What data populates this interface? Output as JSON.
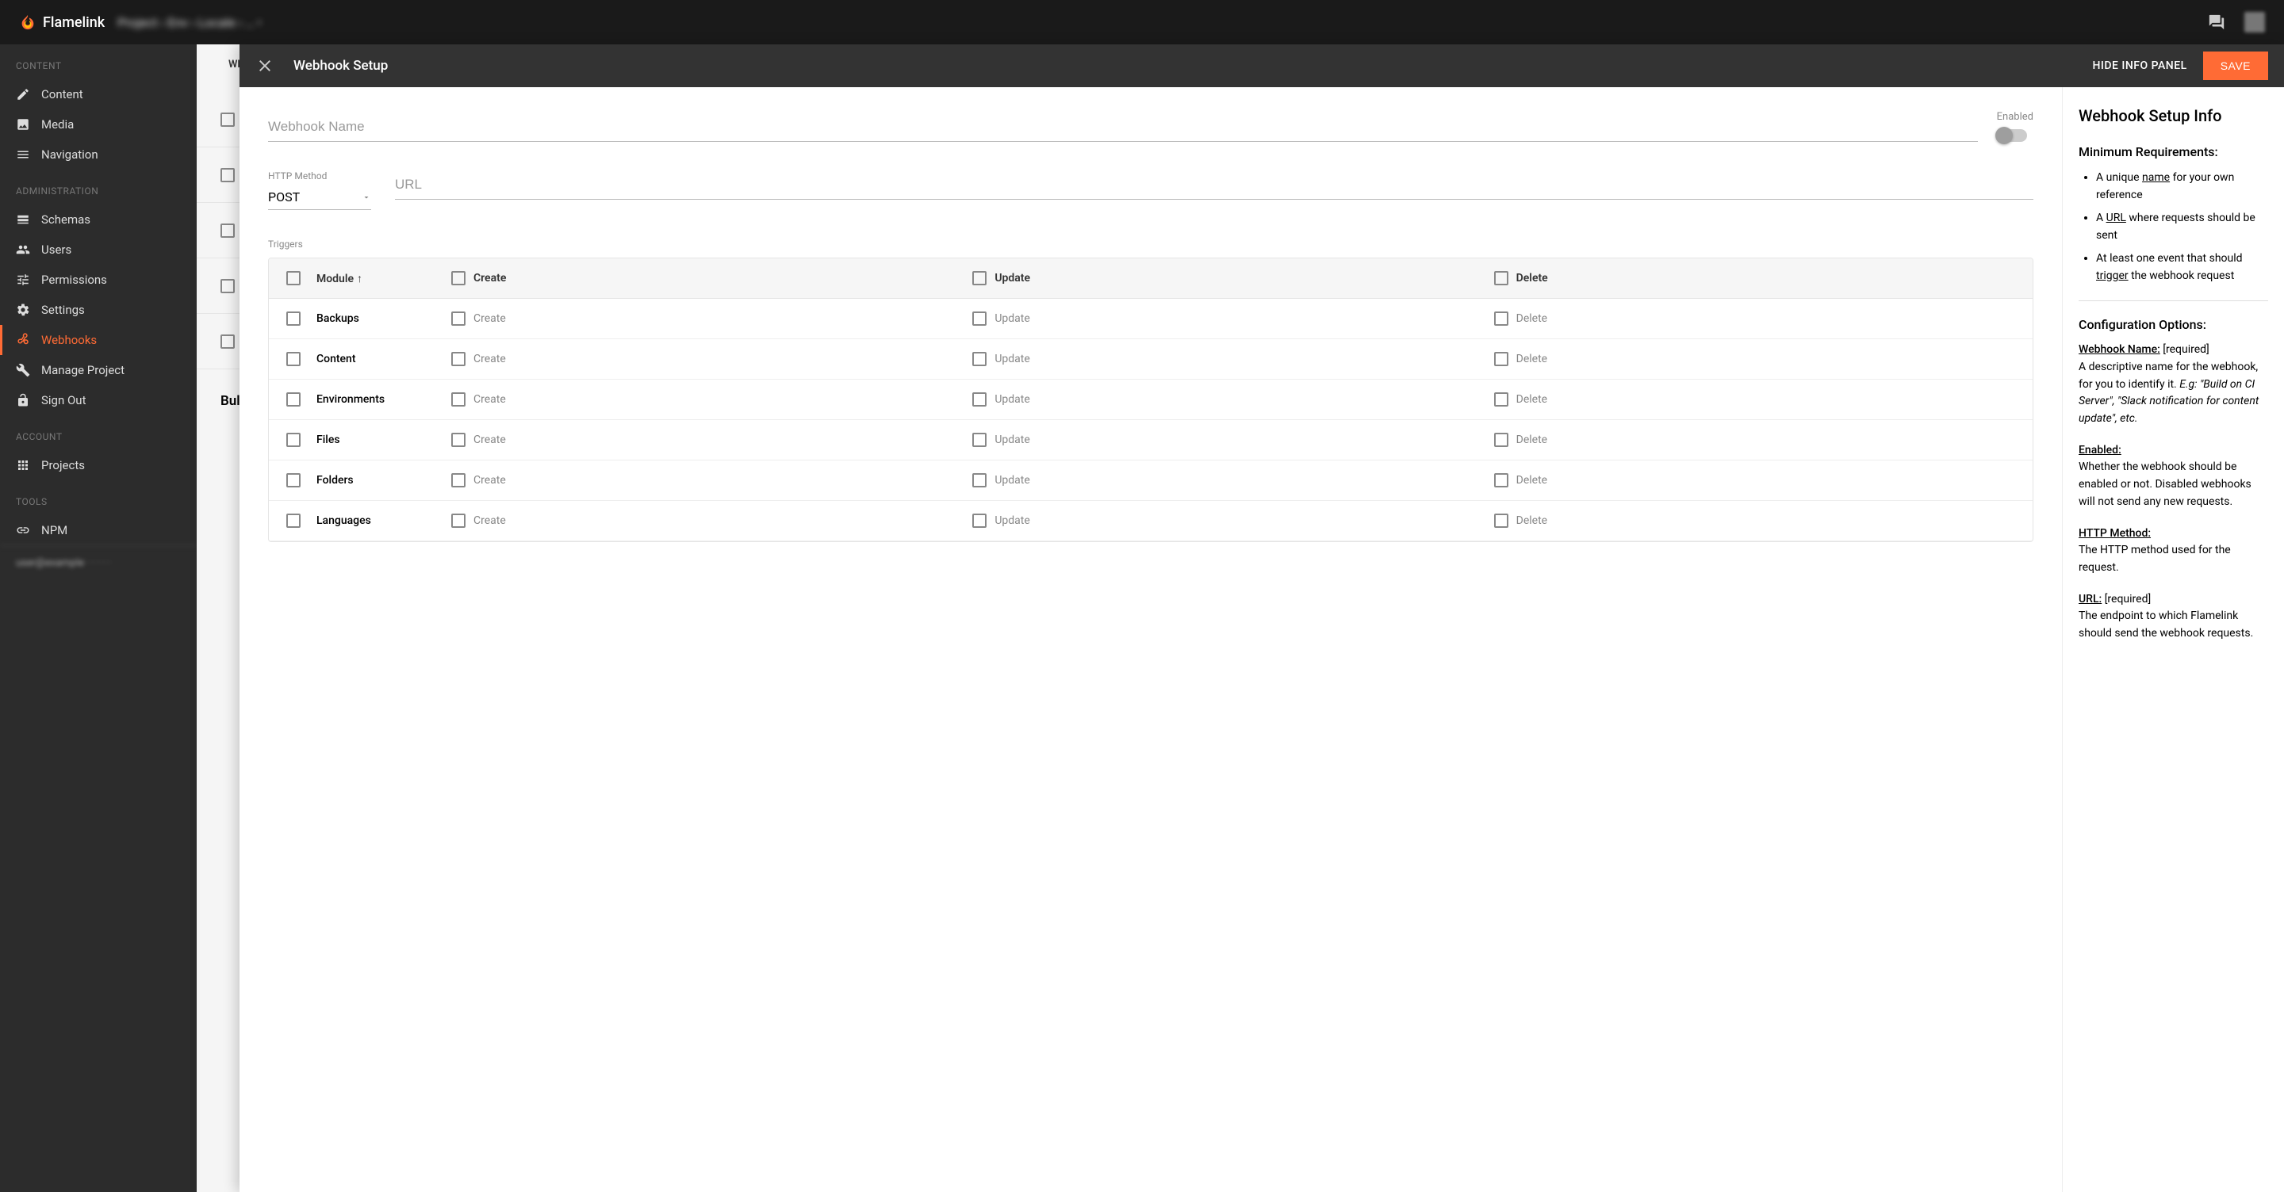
{
  "brand": "Flamelink",
  "breadcrumb_blurred": "Project  ›  Env  ›  Locale  ›  …  •",
  "sidebar": {
    "sections": [
      {
        "title": "CONTENT",
        "items": [
          {
            "label": "Content",
            "icon": "pencil",
            "active": false
          },
          {
            "label": "Media",
            "icon": "image",
            "active": false
          },
          {
            "label": "Navigation",
            "icon": "menu",
            "active": false
          }
        ]
      },
      {
        "title": "ADMINISTRATION",
        "items": [
          {
            "label": "Schemas",
            "icon": "schema",
            "active": false
          },
          {
            "label": "Users",
            "icon": "users",
            "active": false
          },
          {
            "label": "Permissions",
            "icon": "sliders",
            "active": false
          },
          {
            "label": "Settings",
            "icon": "gear",
            "active": false
          },
          {
            "label": "Webhooks",
            "icon": "webhook",
            "active": true
          },
          {
            "label": "Manage Project",
            "icon": "wrench",
            "active": false
          },
          {
            "label": "Sign Out",
            "icon": "lock",
            "active": false
          }
        ]
      },
      {
        "title": "ACCOUNT",
        "items": [
          {
            "label": "Projects",
            "icon": "grid",
            "active": false
          }
        ]
      },
      {
        "title": "TOOLS",
        "items": [
          {
            "label": "NPM",
            "icon": "link",
            "active": false
          }
        ]
      }
    ],
    "footer": "user@example\n· · · · ·"
  },
  "bg": {
    "tab": "WE",
    "rows": 5,
    "bulk": "Bulk"
  },
  "modal": {
    "title": "Webhook Setup",
    "hide_panel": "HIDE INFO PANEL",
    "save": "SAVE",
    "name_placeholder": "Webhook Name",
    "enabled_label": "Enabled",
    "method_label": "HTTP Method",
    "method_value": "POST",
    "url_placeholder": "URL",
    "triggers_label": "Triggers",
    "columns": {
      "module": "Module",
      "create": "Create",
      "update": "Update",
      "delete": "Delete"
    },
    "rows": [
      {
        "module": "Backups"
      },
      {
        "module": "Content"
      },
      {
        "module": "Environments"
      },
      {
        "module": "Files"
      },
      {
        "module": "Folders"
      },
      {
        "module": "Languages"
      }
    ]
  },
  "info": {
    "title": "Webhook Setup Info",
    "req_title": "Minimum Requirements:",
    "req": [
      "A unique <u>name</u> for your own reference",
      "A <u>URL</u> where requests should be sent",
      "At least one event that should <u>trigger</u> the webhook request"
    ],
    "opts_title": "Configuration Options:",
    "opts": [
      "<u>Webhook Name:</u> [required]<br>A descriptive name for the webhook, for you to identify it. <i>E.g: \"Build on CI Server\", \"Slack notification for content update\", etc.</i>",
      "<u>Enabled:</u><br>Whether the webhook should be enabled or not. Disabled webhooks will not send any new requests.",
      "<u>HTTP Method:</u><br>The HTTP method used for the request.",
      "<u>URL:</u> [required]<br>The endpoint to which Flamelink should send the webhook requests."
    ]
  }
}
